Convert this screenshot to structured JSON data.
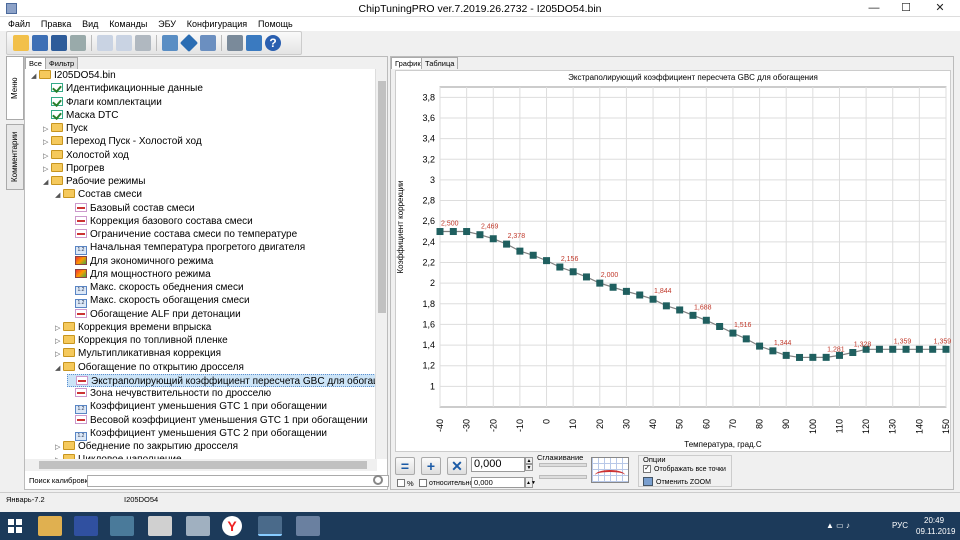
{
  "window": {
    "title": "ChipTuningPRO ver.7.2019.26.2732 - I205DO54.bin",
    "controls": {
      "minimize": "—",
      "maximize": "☐",
      "close": "✕"
    }
  },
  "menu": [
    "Файл",
    "Правка",
    "Вид",
    "Команды",
    "ЭБУ",
    "Конфигурация",
    "Помощь"
  ],
  "toolbar_icons": [
    "open-icon",
    "save-icon",
    "save-all-icon",
    "print-icon",
    "copy-icon",
    "paste-icon",
    "undo-icon",
    "calc-icon",
    "navigate-icon",
    "zoom-icon",
    "settings-icon",
    "refresh-icon",
    "help-icon"
  ],
  "left_vertical_tabs": [
    "Меню калибровок",
    "Комментарии"
  ],
  "left_tabs": [
    "Все",
    "Фильтр"
  ],
  "tree": [
    {
      "label": "I205DO54.bin",
      "level": 0,
      "icon": "folder",
      "arrow": "◢"
    },
    {
      "label": "Идентификационные данные",
      "level": 1,
      "icon": "check",
      "arrow": ""
    },
    {
      "label": "Флаги комплектации",
      "level": 1,
      "icon": "check",
      "arrow": ""
    },
    {
      "label": "Маска DTC",
      "level": 1,
      "icon": "check",
      "arrow": ""
    },
    {
      "label": "Пуск",
      "level": 1,
      "icon": "folder",
      "arrow": "▷"
    },
    {
      "label": "Переход Пуск - Холостой ход",
      "level": 1,
      "icon": "folder",
      "arrow": "▷"
    },
    {
      "label": "Холостой ход",
      "level": 1,
      "icon": "folder",
      "arrow": "▷"
    },
    {
      "label": "Прогрев",
      "level": 1,
      "icon": "folder",
      "arrow": "▷"
    },
    {
      "label": "Рабочие режимы",
      "level": 1,
      "icon": "folder",
      "arrow": "◢"
    },
    {
      "label": "Состав смеси",
      "level": 2,
      "icon": "folder",
      "arrow": "◢"
    },
    {
      "label": "Базовый состав смеси",
      "level": 3,
      "icon": "curve",
      "arrow": ""
    },
    {
      "label": "Коррекция базового состава смеси",
      "level": 3,
      "icon": "curve",
      "arrow": ""
    },
    {
      "label": "Ограничение состава смеси по температуре",
      "level": 3,
      "icon": "curve",
      "arrow": ""
    },
    {
      "label": "Начальная температура прогретого двигателя",
      "level": 3,
      "icon": "num",
      "arrow": ""
    },
    {
      "label": "Для экономичного режима",
      "level": 3,
      "icon": "map3d",
      "arrow": ""
    },
    {
      "label": "Для мощностного режима",
      "level": 3,
      "icon": "map3d",
      "arrow": ""
    },
    {
      "label": "Макс. скорость обеднения смеси",
      "level": 3,
      "icon": "num",
      "arrow": ""
    },
    {
      "label": "Макс. скорость обогащения смеси",
      "level": 3,
      "icon": "num",
      "arrow": ""
    },
    {
      "label": "Обогащение ALF при детонации",
      "level": 3,
      "icon": "curve",
      "arrow": ""
    },
    {
      "label": "Коррекция времени впрыска",
      "level": 2,
      "icon": "folder",
      "arrow": "▷"
    },
    {
      "label": "Коррекция по топливной пленке",
      "level": 2,
      "icon": "folder",
      "arrow": "▷"
    },
    {
      "label": "Мультипликативная коррекция",
      "level": 2,
      "icon": "folder",
      "arrow": "▷"
    },
    {
      "label": "Обогащение по открытию дросселя",
      "level": 2,
      "icon": "folder",
      "arrow": "◢"
    },
    {
      "label": "Экстраполирующий коэффициент пересчета GBC для обогащения",
      "level": 3,
      "icon": "curve",
      "arrow": "",
      "selected": true
    },
    {
      "label": "Зона нечувствительности по дросселю",
      "level": 3,
      "icon": "curve",
      "arrow": ""
    },
    {
      "label": "Коэффициент уменьшения GTC 1 при обогащении",
      "level": 3,
      "icon": "num",
      "arrow": ""
    },
    {
      "label": "Весовой коэффициент уменьшения GTC 1 при обогащении",
      "level": 3,
      "icon": "curve",
      "arrow": ""
    },
    {
      "label": "Коэффициент уменьшения GTC 2 при обогащении",
      "level": 3,
      "icon": "num",
      "arrow": ""
    },
    {
      "label": "Обеднение по закрытию дросселя",
      "level": 2,
      "icon": "folder",
      "arrow": "▷"
    },
    {
      "label": "Цикловое наполнение",
      "level": 2,
      "icon": "folder",
      "arrow": "▷"
    }
  ],
  "search": {
    "label": "Поиск калибровки",
    "value": ""
  },
  "right_tabs": [
    "График",
    "Таблица"
  ],
  "chart_data": {
    "type": "line",
    "title": "Экстраполирующий коэффициент пересчета GBC для обогащения",
    "xlabel": "Температура, град.С",
    "ylabel": "Коэффициент коррекции",
    "xlim": [
      -40,
      150
    ],
    "ylim": [
      0.8,
      3.9
    ],
    "xticks": [
      -40,
      -30,
      -20,
      -10,
      0,
      10,
      20,
      30,
      40,
      50,
      60,
      70,
      80,
      90,
      100,
      110,
      120,
      130,
      140,
      150
    ],
    "yticks": [
      1,
      1.2,
      1.4,
      1.6,
      1.8,
      2,
      2.2,
      2.4,
      2.6,
      2.8,
      3,
      3.2,
      3.4,
      3.6,
      3.8
    ],
    "ytick_labels": [
      "1",
      "1,2",
      "1,4",
      "1,6",
      "1,8",
      "2",
      "2,2",
      "2,4",
      "2,6",
      "2,8",
      "3",
      "3,2",
      "3,4",
      "3,6",
      "3,8"
    ],
    "grid": true,
    "series": [
      {
        "x": [
          -40,
          -35,
          -30,
          -25,
          -20,
          -15,
          -10,
          -5,
          0,
          5,
          10,
          15,
          20,
          25,
          30,
          35,
          40,
          45,
          50,
          55,
          60,
          65,
          70,
          75,
          80,
          85,
          90,
          95,
          100,
          105,
          110,
          115,
          120,
          125,
          130,
          135,
          140,
          145,
          150
        ],
        "y": [
          2.5,
          2.5,
          2.5,
          2.469,
          2.43,
          2.378,
          2.31,
          2.27,
          2.218,
          2.156,
          2.11,
          2.06,
          2.0,
          1.96,
          1.92,
          1.885,
          1.844,
          1.78,
          1.74,
          1.688,
          1.64,
          1.58,
          1.516,
          1.46,
          1.39,
          1.344,
          1.3,
          1.28,
          1.281,
          1.281,
          1.3,
          1.328,
          1.359,
          1.359,
          1.359,
          1.359,
          1.359,
          1.359,
          1.359
        ]
      }
    ],
    "annotations": [
      {
        "x": -40,
        "y": 2.5,
        "text": "2,500"
      },
      {
        "x": -25,
        "y": 2.469,
        "text": "2,469"
      },
      {
        "x": -15,
        "y": 2.378,
        "text": "2,378"
      },
      {
        "x": 5,
        "y": 2.156,
        "text": "2,156"
      },
      {
        "x": 20,
        "y": 2.0,
        "text": "2,000"
      },
      {
        "x": 40,
        "y": 1.844,
        "text": "1,844"
      },
      {
        "x": 55,
        "y": 1.688,
        "text": "1,688"
      },
      {
        "x": 70,
        "y": 1.516,
        "text": "1,516"
      },
      {
        "x": 85,
        "y": 1.344,
        "text": "1,344"
      },
      {
        "x": 105,
        "y": 1.281,
        "text": "1,281"
      },
      {
        "x": 115,
        "y": 1.328,
        "text": "1,328"
      },
      {
        "x": 130,
        "y": 1.359,
        "text": "1,359"
      },
      {
        "x": 145,
        "y": 1.359,
        "text": "1,359"
      }
    ],
    "line_color": "#808080",
    "marker_color": "#1f5f5f",
    "label_color": "#c0392b"
  },
  "controls": {
    "value": "0,000",
    "percent_label": "%",
    "relative_label": "относительно",
    "relative_value": "0,000",
    "smoothing_label": "Сглаживание",
    "options_label": "Опции",
    "show_all_points_label": "Отображать все точки",
    "cancel_zoom_label": "Отменить ZOOM"
  },
  "status": {
    "left": "Январь-7.2",
    "right": "I205DO54"
  },
  "taskbar": {
    "lang": "РУС",
    "time": "20:49",
    "date": "09.11.2019"
  }
}
